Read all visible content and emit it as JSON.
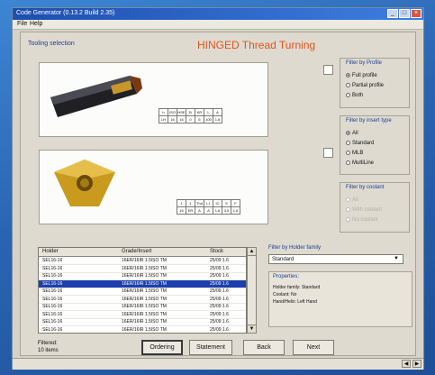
{
  "window": {
    "title": "Code Generator (0.13.2 Build 2.35)"
  },
  "menu": {
    "items": [
      "File",
      "Help"
    ]
  },
  "section": {
    "tooling_selection": "Tooling selection"
  },
  "heading": {
    "title": "HINGED Thread Turning"
  },
  "spec_table_1": {
    "rows": [
      [
        "h",
        "ISO",
        "HSE",
        "B",
        "KR",
        "L",
        "A"
      ],
      [
        "LH",
        "16",
        "16",
        "0",
        "6",
        "100",
        "1.6"
      ]
    ]
  },
  "spec_table_2": {
    "rows": [
      [
        "1",
        "1",
        "Thd",
        "L1",
        "IC",
        "S",
        "F"
      ],
      [
        "16",
        "ER",
        "A",
        "A",
        "1.6",
        "3.5",
        "1.6"
      ]
    ]
  },
  "filter_profile": {
    "title": "Filter by Profile",
    "options": [
      {
        "label": "Full profile",
        "selected": true
      },
      {
        "label": "Partial profile",
        "selected": false
      },
      {
        "label": "Both",
        "selected": false
      }
    ]
  },
  "filter_insert_type": {
    "title": "Filter by insert type",
    "options": [
      {
        "label": "All",
        "selected": true
      },
      {
        "label": "Standard",
        "selected": false
      },
      {
        "label": "MLB",
        "selected": false
      },
      {
        "label": "MultiLine",
        "selected": false
      }
    ]
  },
  "filter_coolant": {
    "title": "Filter by coolant",
    "options": [
      {
        "label": "All",
        "selected": false
      },
      {
        "label": "With coolant",
        "selected": false
      },
      {
        "label": "No coolant",
        "selected": false
      }
    ]
  },
  "list": {
    "columns": [
      "Holder",
      "Grade/Insert",
      "Stock"
    ],
    "rows": [
      [
        "SEL16-16",
        "16ER/16IR 1.5ISO TM",
        "25/09 1.6"
      ],
      [
        "SEL16-16",
        "16ER/16IR 1.5ISO TM",
        "25/09 1.6"
      ],
      [
        "SEL16-16",
        "16ER/16IR 1.5ISO TM",
        "25/09 1.6"
      ],
      [
        "SEL16-16",
        "16ER/16IR 1.5ISO TM",
        "25/09 1.6"
      ],
      [
        "SEL16-16",
        "16ER/16IR 1.5ISO TM",
        "25/09 1.6"
      ],
      [
        "SEL16-16",
        "16ER/16IR 1.5ISO TM",
        "25/09 1.6"
      ],
      [
        "SEL16-16",
        "16ER/16IR 1.5ISO TM",
        "25/09 1.6"
      ],
      [
        "SEL16-16",
        "16ER/16IR 1.5ISO TM",
        "25/09 1.6"
      ],
      [
        "SEL16-16",
        "16ER/16IR 1.5ISO TM",
        "25/09 1.6"
      ],
      [
        "SEL16-16",
        "16ER/16IR 1.5ISO TM",
        "25/09 1.6"
      ]
    ],
    "selected_index": 3
  },
  "sort": {
    "title": "Filter by Holder family",
    "value": "Standard"
  },
  "properties": {
    "title": "Properties:",
    "lines": [
      "Holder family: Standard",
      "Coolant: No",
      "Hand/Helix: Left Hand"
    ]
  },
  "found": {
    "line1": "Filtered:",
    "line2": "10 items"
  },
  "buttons": {
    "ordering": "Ordering",
    "statement": "Statement",
    "back": "Back",
    "next": "Next"
  },
  "colors": {
    "accent": "#e8531c",
    "selection": "#1d3fae",
    "title_bar": "#1d4fb0"
  }
}
